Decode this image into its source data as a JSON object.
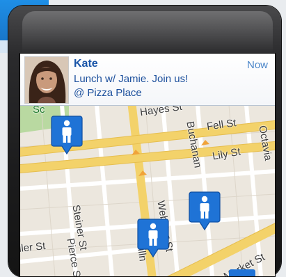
{
  "notification": {
    "name": "Kate",
    "time": "Now",
    "message": "Lunch w/ Jamie. Join us!",
    "place": "@ Pizza Place",
    "avatar": "avatar-photo"
  },
  "map": {
    "streets": {
      "hayes": "Hayes St",
      "fell": "Fell St",
      "lily": "Lily St",
      "steiner": "Steiner St",
      "pierce": "Pierce St",
      "buchanan": "Buchanan",
      "webster": "Webster St",
      "fillmore": "Filln",
      "octavia": "Octavia",
      "market": "Market St",
      "waller": "ller St",
      "partial_sq": "Sc"
    },
    "pins": [
      "person-pin-icon",
      "person-pin-icon",
      "person-pin-icon"
    ]
  },
  "colors": {
    "accent": "#1a6fd1",
    "pin": "#1f73d6",
    "road_major": "#f5d67a",
    "park": "#b9d9a1"
  }
}
